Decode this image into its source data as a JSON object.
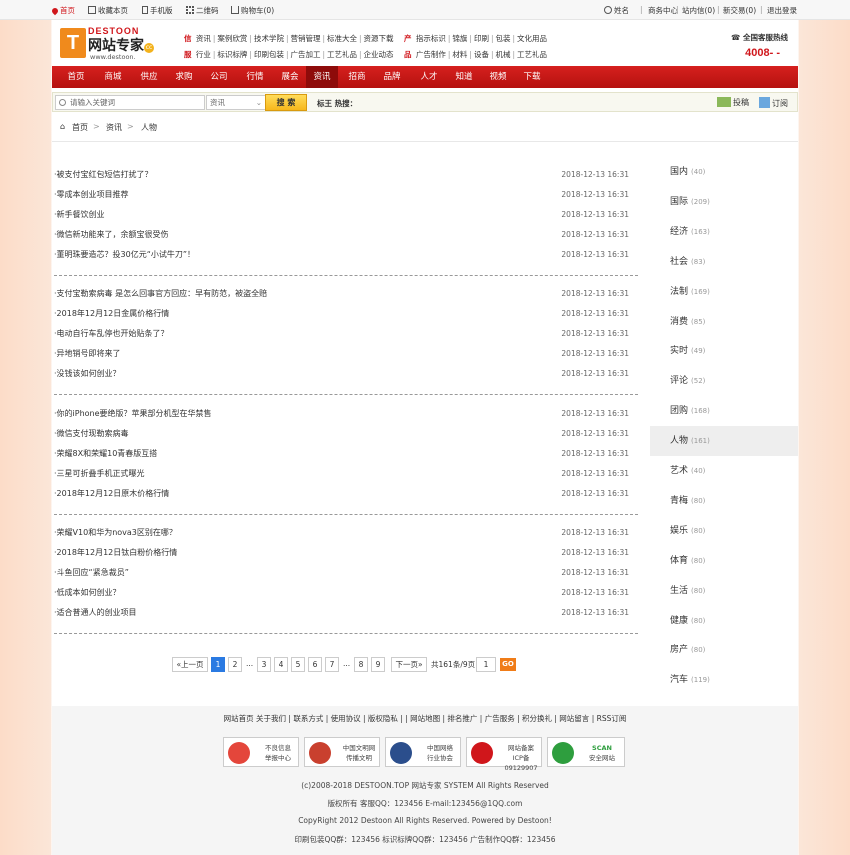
{
  "topbar": {
    "home": "首页",
    "favorite": "收藏本页",
    "mobile": "手机版",
    "qrcode": "二维码",
    "cart": "购物车(0)",
    "user": "姓名",
    "biz": "商务中心",
    "msg": "站内信(0)",
    "trade": "新交易(0)",
    "logout": "退出登录"
  },
  "logo": {
    "en": "DESTOON",
    "cn": "网站专家",
    "url": "www.destoon.",
    "mark": "cc"
  },
  "header": {
    "group1_key": "信",
    "group1": [
      "资讯",
      "案例欣赏",
      "技术学院",
      "营销管理",
      "标准大全",
      "资源下载"
    ],
    "group2_key": "产",
    "group2": [
      "指示标识",
      "锦旗",
      "印刷",
      "包装",
      "文化用品"
    ],
    "group3_key": "服",
    "group3": [
      "行业",
      "标识标牌",
      "印刷包装",
      "广告加工",
      "工艺礼品",
      "企业动态"
    ],
    "group4_key": "品",
    "group4": [
      "广告制作",
      "材料",
      "设备",
      "机械",
      "工艺礼品"
    ],
    "hotline": "全国客服热线",
    "phone": "4008-    -"
  },
  "nav": [
    "首页",
    "商城",
    "供应",
    "求购",
    "公司",
    "行情",
    "展会",
    "资讯",
    "招商",
    "品牌",
    "人才",
    "知道",
    "视频",
    "下载"
  ],
  "nav_active": "资讯",
  "search": {
    "placeholder": "请输入关键词",
    "select": "资讯",
    "button": "搜 索",
    "hot": "标王 热搜：",
    "post": "投稿",
    "rss": "订阅"
  },
  "breadcrumb": [
    "首页",
    "资讯",
    "人物"
  ],
  "groups": [
    [
      {
        "t": "被支付宝红包短信打扰了？",
        "d": "2018-12-13 16:31"
      },
      {
        "t": "零成本创业项目推荐",
        "d": "2018-12-13 16:31"
      },
      {
        "t": "新手餐饮创业",
        "d": "2018-12-13 16:31"
      },
      {
        "t": "微信新功能来了，余额宝很受伤",
        "d": "2018-12-13 16:31"
      },
      {
        "t": "董明珠要造芯？投30亿元“小试牛刀”！",
        "d": "2018-12-13 16:31"
      }
    ],
    [
      {
        "t": "支付宝勒索病毒 是怎么回事官方回应：早有防范，被盗全赔",
        "d": "2018-12-13 16:31"
      },
      {
        "t": "2018年12月12日金属价格行情",
        "d": "2018-12-13 16:31"
      },
      {
        "t": "电动自行车乱停也开始贴条了？",
        "d": "2018-12-13 16:31"
      },
      {
        "t": "异地销号即将来了",
        "d": "2018-12-13 16:31"
      },
      {
        "t": "没钱该如何创业？",
        "d": "2018-12-13 16:31"
      }
    ],
    [
      {
        "t": "你的iPhone要绝版？苹果部分机型在华禁售",
        "d": "2018-12-13 16:31"
      },
      {
        "t": "微信支付现勒索病毒",
        "d": "2018-12-13 16:31"
      },
      {
        "t": "荣耀8X和荣耀10青春版互搭",
        "d": "2018-12-13 16:31"
      },
      {
        "t": "三星可折叠手机正式曝光",
        "d": "2018-12-13 16:31"
      },
      {
        "t": "2018年12月12日原木价格行情",
        "d": "2018-12-13 16:31"
      }
    ],
    [
      {
        "t": "荣耀V10和华为nova3区别在哪？",
        "d": "2018-12-13 16:31"
      },
      {
        "t": "2018年12月12日钛白粉价格行情",
        "d": "2018-12-13 16:31"
      },
      {
        "t": "斗鱼回应“紧急裁员”",
        "d": "2018-12-13 16:31"
      },
      {
        "t": "低成本如何创业？",
        "d": "2018-12-13 16:31"
      },
      {
        "t": "适合普通人的创业项目",
        "d": "2018-12-13 16:31"
      }
    ]
  ],
  "categories": [
    {
      "n": "国内",
      "c": "(40)"
    },
    {
      "n": "国际",
      "c": "(209)"
    },
    {
      "n": "经济",
      "c": "(163)"
    },
    {
      "n": "社会",
      "c": "(83)"
    },
    {
      "n": "法制",
      "c": "(169)"
    },
    {
      "n": "消费",
      "c": "(85)"
    },
    {
      "n": "实时",
      "c": "(49)"
    },
    {
      "n": "评论",
      "c": "(52)"
    },
    {
      "n": "团购",
      "c": "(168)"
    },
    {
      "n": "人物",
      "c": "(161)"
    },
    {
      "n": "艺术",
      "c": "(40)"
    },
    {
      "n": "青梅",
      "c": "(80)"
    },
    {
      "n": "娱乐",
      "c": "(80)"
    },
    {
      "n": "体育",
      "c": "(80)"
    },
    {
      "n": "生活",
      "c": "(80)"
    },
    {
      "n": "健康",
      "c": "(80)"
    },
    {
      "n": "房产",
      "c": "(80)"
    },
    {
      "n": "汽车",
      "c": "(119)"
    }
  ],
  "category_active": "人物",
  "pager": {
    "prev": "«上一页",
    "pages": [
      "1",
      "2",
      "...",
      "3",
      "4",
      "5",
      "6",
      "7",
      "...",
      "8",
      "9"
    ],
    "current": "1",
    "next": "下一页»",
    "total": "共161条/9页",
    "input": "1",
    "go": "GO"
  },
  "footer": {
    "links": "网站首页 关于我们 | 联系方式 | 使用协议 | 版权隐私 | | 网站地图 | 排名推广 | 广告服务 | 积分换礼 | 网站留言 | RSS订阅",
    "badges": [
      [
        "不良信息",
        "举报中心"
      ],
      [
        "中国文明网",
        "传播文明"
      ],
      [
        "中国网络",
        "行业协会"
      ],
      [
        "网站备案",
        "ICP备09129907"
      ],
      [
        "SCAN",
        "安全网站"
      ]
    ],
    "copy": [
      "(c)2008-2018 DESTOON.TOP 网站专家 SYSTEM All Rights Reserved",
      "版权所有 客服QQ：123456 E-mail:123456@1QQ.com",
      "CopyRight 2012 Destoon All Rights Reserved. Powered by Destoon!",
      "印刷包装QQ群：123456 标识标牌QQ群：123456 广告制作QQ群：123456"
    ]
  },
  "colors": {
    "brand": "#d0161b",
    "nav_active": "#8e0b0a",
    "accent": "#f08a1c",
    "page_active": "#2a7ae2"
  }
}
